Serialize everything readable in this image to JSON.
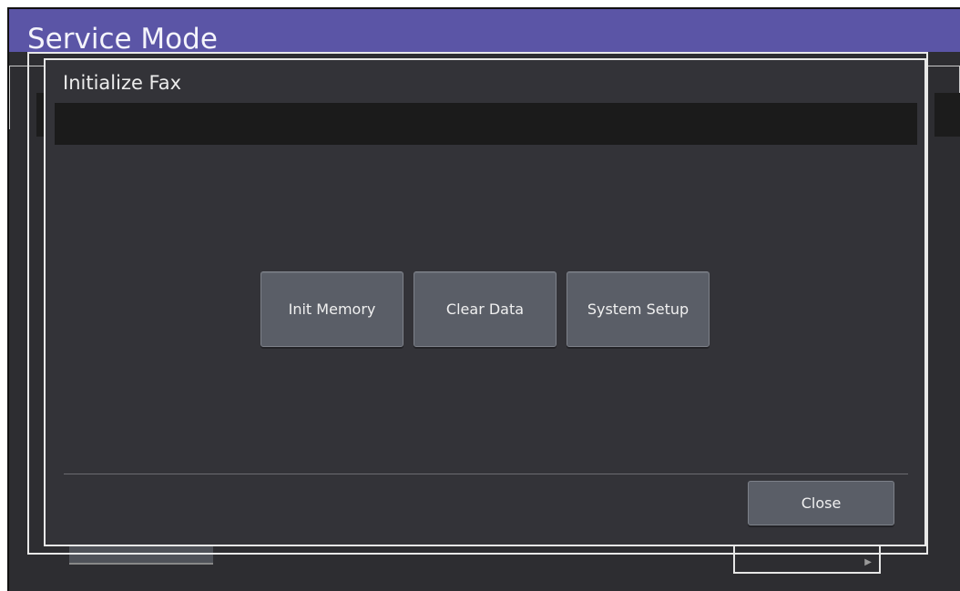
{
  "window": {
    "title": "Service Mode"
  },
  "dialog": {
    "title": "Initialize Fax",
    "buttons": [
      "Init Memory",
      "Clear Data",
      "System Setup"
    ],
    "close_label": "Close"
  },
  "colors": {
    "title_bar": "#5b55a6",
    "background": "#2d2d31",
    "dialog": "#333338",
    "button": "#5a5e67"
  }
}
